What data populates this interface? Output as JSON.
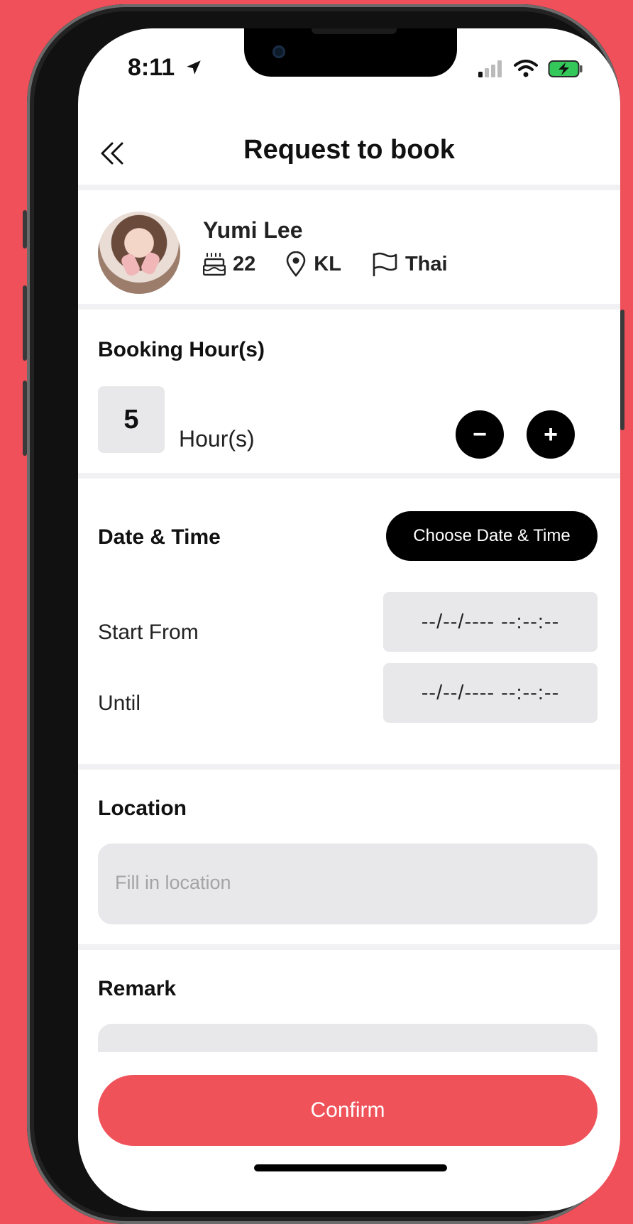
{
  "status_bar": {
    "time": "8:11"
  },
  "header": {
    "title": "Request to book",
    "back_icon": "double-chevron-left-icon"
  },
  "profile": {
    "name": "Yumi Lee",
    "age": "22",
    "location": "KL",
    "nationality": "Thai"
  },
  "booking_hours": {
    "label": "Booking Hour(s)",
    "value": "5",
    "unit": "Hour(s)",
    "minus_label": "−",
    "plus_label": "+"
  },
  "date_time": {
    "label": "Date & Time",
    "choose_label": "Choose Date & Time",
    "start_label": "Start From",
    "start_value": "--/--/---- --:--:--",
    "until_label": "Until",
    "until_value": "--/--/---- --:--:--"
  },
  "location": {
    "label": "Location",
    "placeholder": "Fill in location"
  },
  "remark": {
    "label": "Remark"
  },
  "confirm_label": "Confirm",
  "colors": {
    "brand": "#f0525a",
    "field_bg": "#e8e8ea",
    "button_dark": "#000000"
  }
}
